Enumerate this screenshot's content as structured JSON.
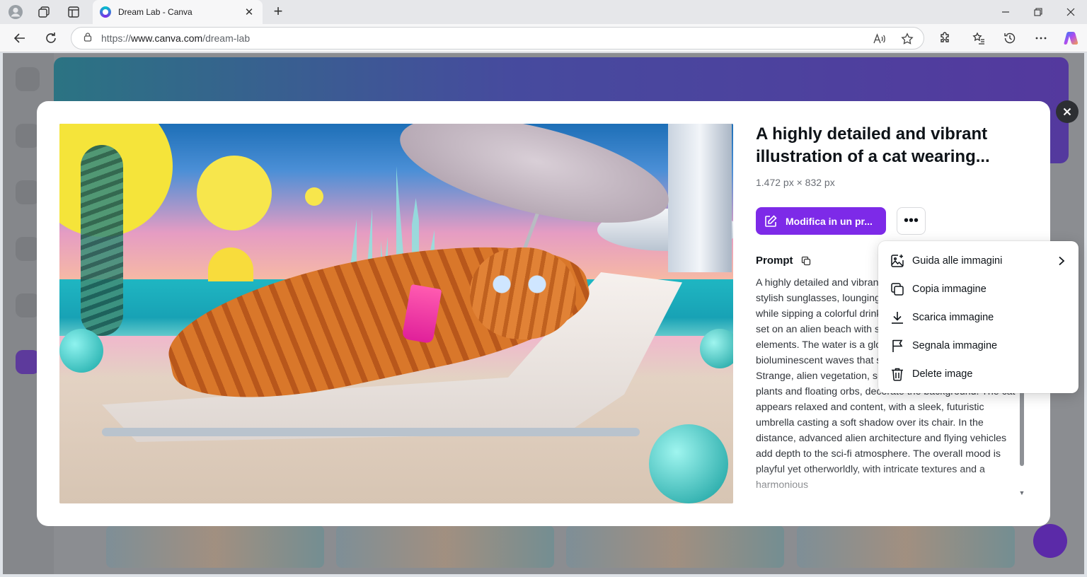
{
  "browser": {
    "tab_title": "Dream Lab - Canva",
    "tab_close": "✕",
    "new_tab": "+",
    "url_prefix": "https://",
    "url_domain": "www.canva.com",
    "url_path": "/dream-lab"
  },
  "modal": {
    "close": "✕",
    "title": "A highly detailed and vibrant illustration of a cat wearing...",
    "dimensions": "1.472 px × 832 px",
    "edit_button": "Modifica in un pr...",
    "more_button": "•••",
    "prompt_label": "Prompt",
    "prompt_text": "A highly detailed and vibrant illustration of a cat wearing stylish sunglasses, lounging on a futuristic beach chair while sipping a colorful drink through a straw. The scene is set on an alien beach with surreal and science-fiction elements. The water is a glowing teal color, and there are bioluminescent waves that shimmer under the sky. Strange, alien vegetation, such as towering crystalline plants and floating orbs, decorate the background. The cat appears relaxed and content, with a sleek, futuristic umbrella casting a soft shadow over its chair. In the distance, advanced alien architecture and flying vehicles add depth to the sci-fi atmosphere. The overall mood is playful yet otherworldly, with intricate textures and a harmonious"
  },
  "menu": {
    "items": [
      {
        "label": "Guida alle immagini",
        "icon": "image-sparkle-icon",
        "has_submenu": true
      },
      {
        "label": "Copia immagine",
        "icon": "copy-icon"
      },
      {
        "label": "Scarica immagine",
        "icon": "download-icon"
      },
      {
        "label": "Segnala immagine",
        "icon": "flag-icon"
      },
      {
        "label": "Delete image",
        "icon": "trash-icon"
      }
    ]
  },
  "colors": {
    "accent": "#7d2ae8",
    "modal_close_bg": "#2d2f33"
  }
}
